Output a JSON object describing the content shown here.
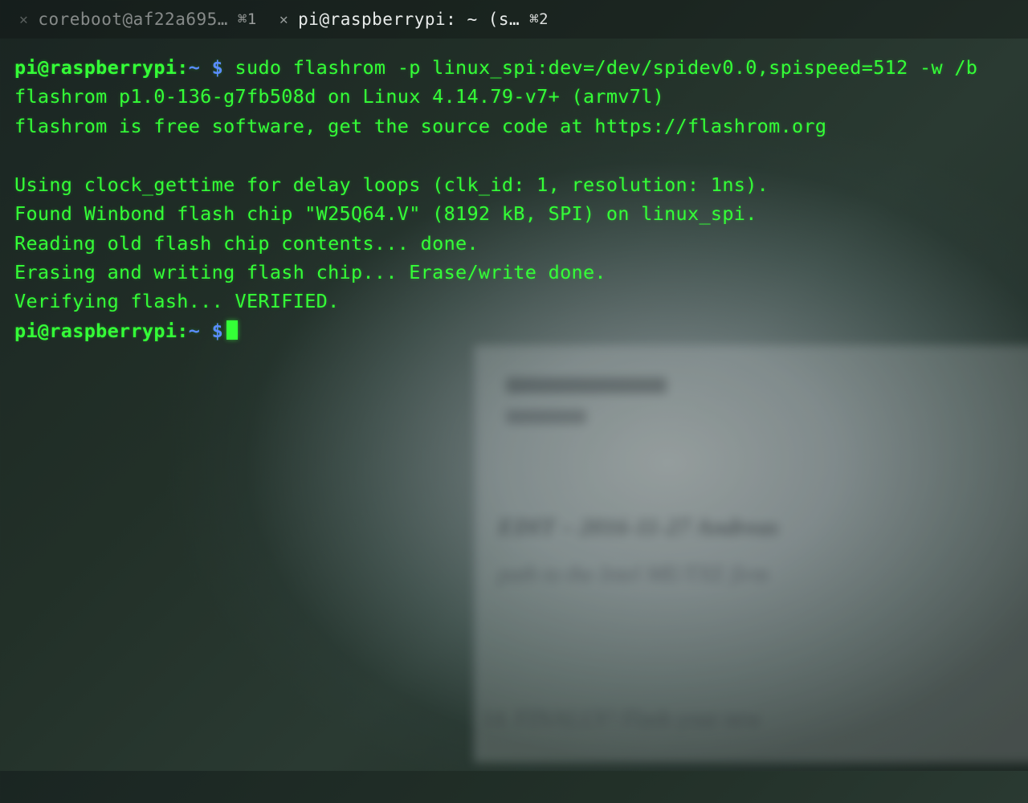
{
  "tabs": [
    {
      "title": "coreboot@af22a695…",
      "shortcut": "⌘1",
      "active": false
    },
    {
      "title": "pi@raspberrypi: ~ (s…",
      "shortcut": "⌘2",
      "active": true
    }
  ],
  "prompt": {
    "user_host": "pi@raspberrypi",
    "sep": ":",
    "cwd": "~",
    "sigil": "$"
  },
  "command": "sudo flashrom -p linux_spi:dev=/dev/spidev0.0,spispeed=512 -w /b",
  "output": [
    "flashrom p1.0-136-g7fb508d on Linux 4.14.79-v7+ (armv7l)",
    "flashrom is free software, get the source code at https://flashrom.org",
    "",
    "Using clock_gettime for delay loops (clk_id: 1, resolution: 1ns).",
    "Found Winbond flash chip \"W25Q64.V\" (8192 kB, SPI) on linux_spi.",
    "Reading old flash chip contents... done.",
    "Erasing and writing flash chip... Erase/write done.",
    "Verifying flash... VERIFIED."
  ],
  "ghost": {
    "line1": "EDIT – 2016-11-27 Andreas",
    "line2": "path to the Intel ME/TXE firm",
    "line3": "14. FINALLY! Flash your new"
  }
}
